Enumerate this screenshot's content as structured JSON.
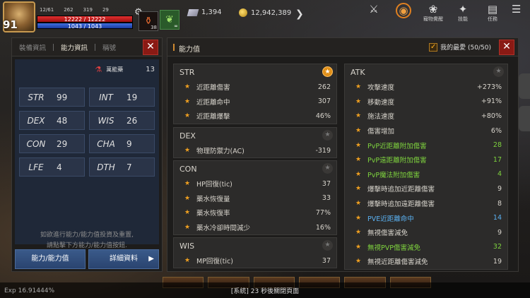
{
  "hud": {
    "level": "91",
    "mini_stats": [
      "12/61",
      "262",
      "319",
      "29"
    ],
    "hp": "12222 / 12222",
    "mp": "1043 / 1043",
    "potion_count": "38",
    "buff_count": "∞",
    "crystals": "1,394",
    "gold": "12,942,389",
    "top_icons": [
      {
        "icon": "dungeon-icon",
        "label": ""
      },
      {
        "icon": "collection-icon",
        "label": ""
      },
      {
        "icon": "pet-icon",
        "label": "寵物覺醒"
      },
      {
        "icon": "skill-icon",
        "label": "技能"
      },
      {
        "icon": "quest-icon",
        "label": "任務"
      }
    ]
  },
  "left_panel": {
    "tabs": [
      "裝備資訊",
      "能力資訊",
      "稱號"
    ],
    "active_tab": 1,
    "elixir_label": "萬能藥",
    "elixir_value": "13",
    "stats": [
      {
        "name": "STR",
        "value": "99"
      },
      {
        "name": "INT",
        "value": "19"
      },
      {
        "name": "DEX",
        "value": "48"
      },
      {
        "name": "WIS",
        "value": "26"
      },
      {
        "name": "CON",
        "value": "29"
      },
      {
        "name": "CHA",
        "value": "9"
      },
      {
        "name": "LFE",
        "value": "4"
      },
      {
        "name": "DTH",
        "value": "7"
      }
    ],
    "hint_line1": "如欲進行能力/能力值投資及重置,",
    "hint_line2": "請點擊下方能力/能力值按鈕.",
    "btn_ability": "能力/能力值",
    "btn_detail": "詳細資料"
  },
  "right_panel": {
    "title": "能力值",
    "favorites": "我的最愛 (50/50)",
    "str": {
      "name": "STR",
      "rows": [
        {
          "label": "近距離傷害",
          "value": "262"
        },
        {
          "label": "近距離命中",
          "value": "307"
        },
        {
          "label": "近距離爆擊",
          "value": "46%"
        }
      ]
    },
    "dex": {
      "name": "DEX",
      "rows": [
        {
          "label": "物理防禦力(AC)",
          "value": "-319"
        }
      ]
    },
    "con": {
      "name": "CON",
      "rows": [
        {
          "label": "HP回復(tic)",
          "value": "37"
        },
        {
          "label": "藥水恢復量",
          "value": "33"
        },
        {
          "label": "藥水恢復率",
          "value": "77%"
        },
        {
          "label": "藥水冷卻時間減少",
          "value": "16%"
        }
      ]
    },
    "wis": {
      "name": "WIS",
      "rows": [
        {
          "label": "MP回復(tic)",
          "value": "37"
        }
      ]
    },
    "atk": {
      "name": "ATK",
      "rows": [
        {
          "label": "攻擊速度",
          "value": "+273%",
          "color": "normal"
        },
        {
          "label": "移動速度",
          "value": "+91%",
          "color": "normal"
        },
        {
          "label": "施法速度",
          "value": "+80%",
          "color": "normal"
        },
        {
          "label": "傷害增加",
          "value": "6%",
          "color": "normal"
        },
        {
          "label": "PvP近距離附加傷害",
          "value": "28",
          "color": "green"
        },
        {
          "label": "PvP遠距離附加傷害",
          "value": "17",
          "color": "green"
        },
        {
          "label": "PvP魔法附加傷害",
          "value": "4",
          "color": "green"
        },
        {
          "label": "爆擊時追加近距離傷害",
          "value": "9",
          "color": "normal"
        },
        {
          "label": "爆擊時追加遠距離傷害",
          "value": "8",
          "color": "normal"
        },
        {
          "label": "PVE近距離命中",
          "value": "14",
          "color": "blue"
        },
        {
          "label": "無視傷害減免",
          "value": "9",
          "color": "normal"
        },
        {
          "label": "無視PVP傷害減免",
          "value": "32",
          "color": "green"
        },
        {
          "label": "無視近距離傷害減免",
          "value": "19",
          "color": "normal"
        }
      ]
    }
  },
  "bottom": {
    "exp": "Exp 16.91444%",
    "system_message": "[系統] 23 秒後關閉頁面"
  }
}
